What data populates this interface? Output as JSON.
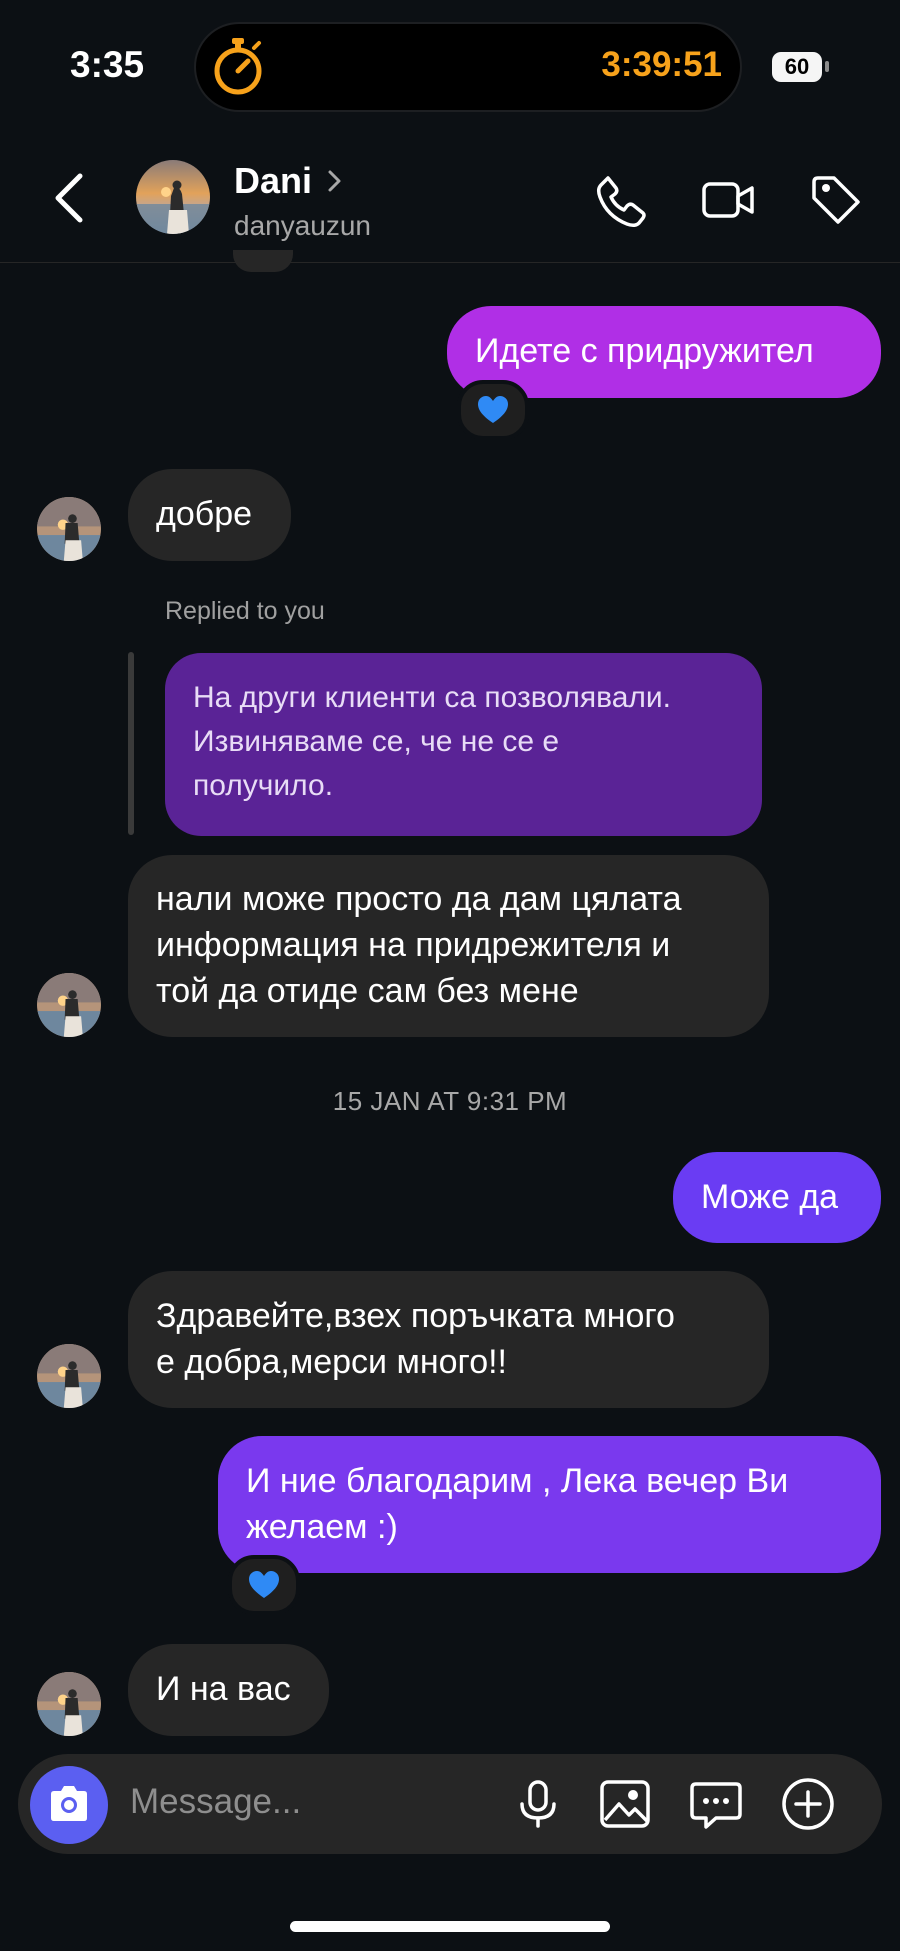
{
  "status_bar": {
    "time": "3:35",
    "timer": "3:39:51",
    "battery": "60"
  },
  "header": {
    "name": "Dani",
    "username": "danyauzun",
    "icons": [
      "back-icon",
      "chevron-right-icon",
      "phone-icon",
      "video-icon",
      "tag-icon"
    ]
  },
  "messages": {
    "m1": {
      "text": "Идете с придружител",
      "reaction": "blue-heart"
    },
    "m2": {
      "text": "добре"
    },
    "reply_label": "Replied to you",
    "quoted": {
      "line1": "На други клиенти са позволявали.",
      "line2": "Извиняваме се, че не се е",
      "line3": "получило."
    },
    "m3": {
      "line1": "нали може просто да дам цялата",
      "line2": "информация на придрежителя и",
      "line3": "той да отиде сам без мене"
    },
    "timestamp": "15 JAN AT 9:31 PM",
    "m4": {
      "text": "Може да"
    },
    "m5": {
      "line1": "Здравейте,взех поръчката много",
      "line2": "е добра,мерси много!!"
    },
    "m6": {
      "line1": "И ние благодарим , Лека вечер Ви",
      "line2": "желаем :)",
      "reaction": "blue-heart"
    },
    "m7": {
      "text": "И на вас"
    }
  },
  "composer": {
    "placeholder": "Message..."
  },
  "colors": {
    "background": "#0c1014",
    "incoming": "#262626",
    "outgoing_magenta": "#b02fe6",
    "outgoing_violet": "#6a3cf3",
    "timer": "#f7a21b",
    "camera_button": "#5b5ff1"
  }
}
